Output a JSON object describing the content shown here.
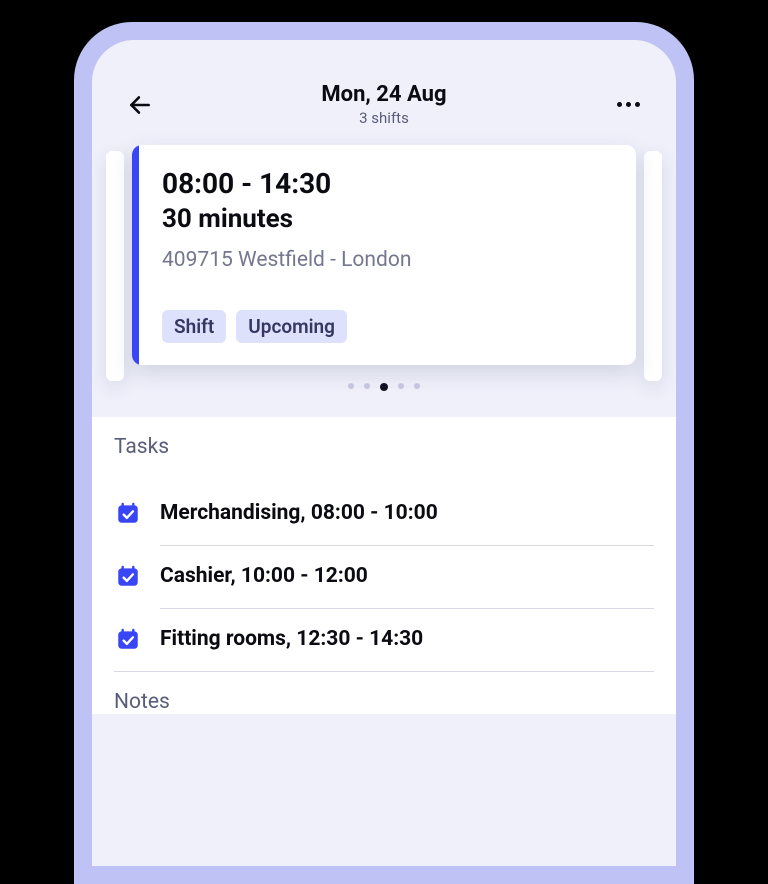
{
  "header": {
    "title": "Mon, 24 Aug",
    "subtitle": "3 shifts"
  },
  "shift": {
    "time_range": "08:00 - 14:30",
    "duration": "30 minutes",
    "location": "409715 Westfield - London",
    "tags": [
      "Shift",
      "Upcoming"
    ]
  },
  "pager": {
    "count": 5,
    "active_index": 2
  },
  "sections": {
    "tasks": {
      "title": "Tasks",
      "items": [
        "Merchandising, 08:00 - 10:00",
        "Cashier, 10:00 - 12:00",
        "Fitting rooms, 12:30 - 14:30"
      ]
    },
    "notes": {
      "title": "Notes"
    }
  },
  "colors": {
    "accent": "#3946F5",
    "tag_bg": "#DDE1FB"
  }
}
